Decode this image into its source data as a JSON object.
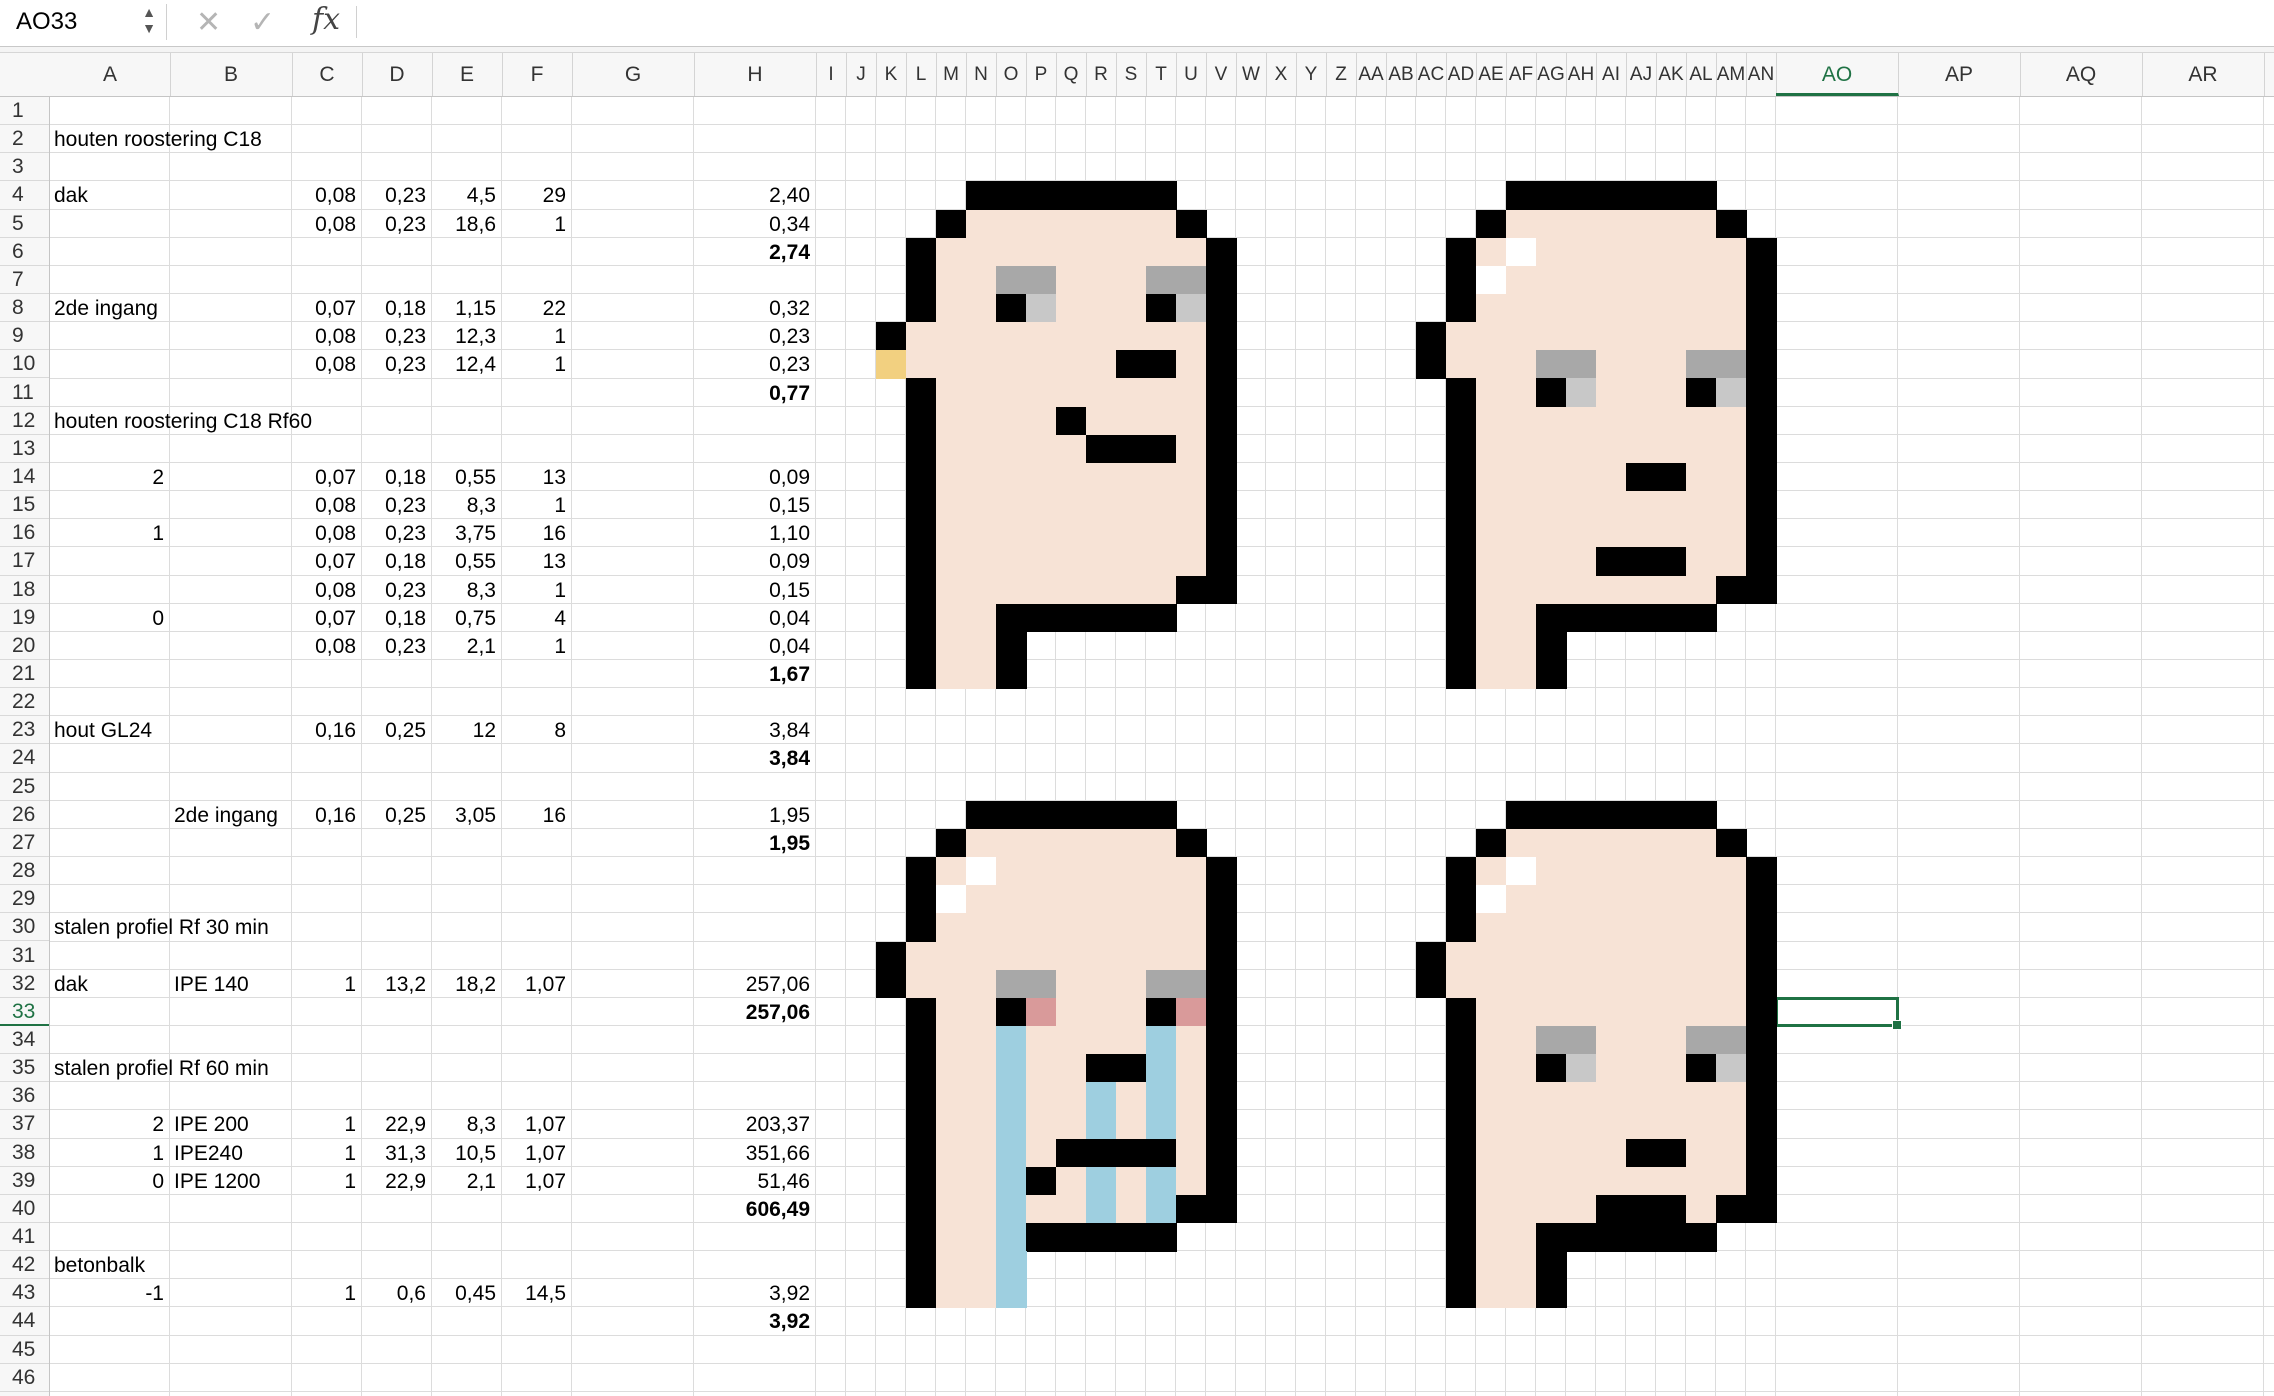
{
  "formula_bar": {
    "name_box": "AO33",
    "cancel_icon": "close-icon",
    "confirm_icon": "check-icon",
    "fx_label": "fx",
    "formula": ""
  },
  "colors": {
    "accent": "#1f7244",
    "skin": "#f7e3d6",
    "outline": "#000000",
    "eyebrow": "#a8a8a8",
    "eye_light": "#c8c8c8",
    "tear": "#9ecfe0",
    "eye_red": "#d99a9a",
    "earring": "#f2d080",
    "shine": "#ffffff"
  },
  "columns": [
    "A",
    "B",
    "C",
    "D",
    "E",
    "F",
    "G",
    "H",
    "I",
    "J",
    "K",
    "L",
    "M",
    "N",
    "O",
    "P",
    "Q",
    "R",
    "S",
    "T",
    "U",
    "V",
    "W",
    "X",
    "Y",
    "Z",
    "AA",
    "AB",
    "AC",
    "AD",
    "AE",
    "AF",
    "AG",
    "AH",
    "AI",
    "AJ",
    "AK",
    "AL",
    "AM",
    "AN",
    "AO",
    "AP",
    "AQ",
    "AR"
  ],
  "column_header_labels": [
    "A",
    "B",
    "C",
    "D",
    "E",
    "F",
    "G",
    "H",
    "I",
    "J",
    "K",
    "L",
    "M",
    "N",
    "O",
    "P",
    "Q",
    "R",
    "S",
    "T",
    "U",
    "V",
    "W",
    "X",
    "Y",
    "Z",
    "AA",
    "AB",
    "AC",
    "AD",
    "AE",
    "AF",
    "AG",
    "AH",
    "AI",
    "AJ",
    "AK",
    "AL",
    "AM",
    "AN",
    "AO",
    "AP",
    "AQ",
    "AR"
  ],
  "rows": [
    "1",
    "2",
    "3",
    "4",
    "5",
    "6",
    "7",
    "8",
    "9",
    "10",
    "11",
    "12",
    "13",
    "14",
    "15",
    "16",
    "17",
    "18",
    "19",
    "20",
    "21",
    "22",
    "23",
    "24",
    "25",
    "26",
    "27",
    "28",
    "29",
    "30",
    "31",
    "32",
    "33",
    "34",
    "35",
    "36",
    "37",
    "38",
    "39",
    "40",
    "41",
    "42",
    "43",
    "44",
    "45",
    "46"
  ],
  "active_cell": {
    "col": "AO",
    "row": "33"
  },
  "cells": [
    {
      "row": 2,
      "col": "A",
      "v": "houten roostering C18"
    },
    {
      "row": 4,
      "col": "A",
      "v": "dak"
    },
    {
      "row": 4,
      "col": "C",
      "v": "0,08",
      "r": 1
    },
    {
      "row": 4,
      "col": "D",
      "v": "0,23",
      "r": 1
    },
    {
      "row": 4,
      "col": "E",
      "v": "4,5",
      "r": 1
    },
    {
      "row": 4,
      "col": "F",
      "v": "29",
      "r": 1
    },
    {
      "row": 4,
      "col": "H",
      "v": "2,40",
      "r": 1
    },
    {
      "row": 5,
      "col": "C",
      "v": "0,08",
      "r": 1
    },
    {
      "row": 5,
      "col": "D",
      "v": "0,23",
      "r": 1
    },
    {
      "row": 5,
      "col": "E",
      "v": "18,6",
      "r": 1
    },
    {
      "row": 5,
      "col": "F",
      "v": "1",
      "r": 1
    },
    {
      "row": 5,
      "col": "H",
      "v": "0,34",
      "r": 1
    },
    {
      "row": 6,
      "col": "H",
      "v": "2,74",
      "r": 1,
      "b": 1
    },
    {
      "row": 8,
      "col": "A",
      "v": "2de ingang"
    },
    {
      "row": 8,
      "col": "C",
      "v": "0,07",
      "r": 1
    },
    {
      "row": 8,
      "col": "D",
      "v": "0,18",
      "r": 1
    },
    {
      "row": 8,
      "col": "E",
      "v": "1,15",
      "r": 1
    },
    {
      "row": 8,
      "col": "F",
      "v": "22",
      "r": 1
    },
    {
      "row": 8,
      "col": "H",
      "v": "0,32",
      "r": 1
    },
    {
      "row": 9,
      "col": "C",
      "v": "0,08",
      "r": 1
    },
    {
      "row": 9,
      "col": "D",
      "v": "0,23",
      "r": 1
    },
    {
      "row": 9,
      "col": "E",
      "v": "12,3",
      "r": 1
    },
    {
      "row": 9,
      "col": "F",
      "v": "1",
      "r": 1
    },
    {
      "row": 9,
      "col": "H",
      "v": "0,23",
      "r": 1
    },
    {
      "row": 10,
      "col": "C",
      "v": "0,08",
      "r": 1
    },
    {
      "row": 10,
      "col": "D",
      "v": "0,23",
      "r": 1
    },
    {
      "row": 10,
      "col": "E",
      "v": "12,4",
      "r": 1
    },
    {
      "row": 10,
      "col": "F",
      "v": "1",
      "r": 1
    },
    {
      "row": 10,
      "col": "H",
      "v": "0,23",
      "r": 1
    },
    {
      "row": 11,
      "col": "H",
      "v": "0,77",
      "r": 1,
      "b": 1
    },
    {
      "row": 12,
      "col": "A",
      "v": "houten roostering C18  Rf60"
    },
    {
      "row": 14,
      "col": "A",
      "v": "2",
      "r": 1
    },
    {
      "row": 14,
      "col": "C",
      "v": "0,07",
      "r": 1
    },
    {
      "row": 14,
      "col": "D",
      "v": "0,18",
      "r": 1
    },
    {
      "row": 14,
      "col": "E",
      "v": "0,55",
      "r": 1
    },
    {
      "row": 14,
      "col": "F",
      "v": "13",
      "r": 1
    },
    {
      "row": 14,
      "col": "H",
      "v": "0,09",
      "r": 1
    },
    {
      "row": 15,
      "col": "C",
      "v": "0,08",
      "r": 1
    },
    {
      "row": 15,
      "col": "D",
      "v": "0,23",
      "r": 1
    },
    {
      "row": 15,
      "col": "E",
      "v": "8,3",
      "r": 1
    },
    {
      "row": 15,
      "col": "F",
      "v": "1",
      "r": 1
    },
    {
      "row": 15,
      "col": "H",
      "v": "0,15",
      "r": 1
    },
    {
      "row": 16,
      "col": "A",
      "v": "1",
      "r": 1
    },
    {
      "row": 16,
      "col": "C",
      "v": "0,08",
      "r": 1
    },
    {
      "row": 16,
      "col": "D",
      "v": "0,23",
      "r": 1
    },
    {
      "row": 16,
      "col": "E",
      "v": "3,75",
      "r": 1
    },
    {
      "row": 16,
      "col": "F",
      "v": "16",
      "r": 1
    },
    {
      "row": 16,
      "col": "H",
      "v": "1,10",
      "r": 1
    },
    {
      "row": 17,
      "col": "C",
      "v": "0,07",
      "r": 1
    },
    {
      "row": 17,
      "col": "D",
      "v": "0,18",
      "r": 1
    },
    {
      "row": 17,
      "col": "E",
      "v": "0,55",
      "r": 1
    },
    {
      "row": 17,
      "col": "F",
      "v": "13",
      "r": 1
    },
    {
      "row": 17,
      "col": "H",
      "v": "0,09",
      "r": 1
    },
    {
      "row": 18,
      "col": "C",
      "v": "0,08",
      "r": 1
    },
    {
      "row": 18,
      "col": "D",
      "v": "0,23",
      "r": 1
    },
    {
      "row": 18,
      "col": "E",
      "v": "8,3",
      "r": 1
    },
    {
      "row": 18,
      "col": "F",
      "v": "1",
      "r": 1
    },
    {
      "row": 18,
      "col": "H",
      "v": "0,15",
      "r": 1
    },
    {
      "row": 19,
      "col": "A",
      "v": "0",
      "r": 1
    },
    {
      "row": 19,
      "col": "C",
      "v": "0,07",
      "r": 1
    },
    {
      "row": 19,
      "col": "D",
      "v": "0,18",
      "r": 1
    },
    {
      "row": 19,
      "col": "E",
      "v": "0,75",
      "r": 1
    },
    {
      "row": 19,
      "col": "F",
      "v": "4",
      "r": 1
    },
    {
      "row": 19,
      "col": "H",
      "v": "0,04",
      "r": 1
    },
    {
      "row": 20,
      "col": "C",
      "v": "0,08",
      "r": 1
    },
    {
      "row": 20,
      "col": "D",
      "v": "0,23",
      "r": 1
    },
    {
      "row": 20,
      "col": "E",
      "v": "2,1",
      "r": 1
    },
    {
      "row": 20,
      "col": "F",
      "v": "1",
      "r": 1
    },
    {
      "row": 20,
      "col": "H",
      "v": "0,04",
      "r": 1
    },
    {
      "row": 21,
      "col": "H",
      "v": "1,67",
      "r": 1,
      "b": 1
    },
    {
      "row": 23,
      "col": "A",
      "v": "hout GL24"
    },
    {
      "row": 23,
      "col": "C",
      "v": "0,16",
      "r": 1
    },
    {
      "row": 23,
      "col": "D",
      "v": "0,25",
      "r": 1
    },
    {
      "row": 23,
      "col": "E",
      "v": "12",
      "r": 1
    },
    {
      "row": 23,
      "col": "F",
      "v": "8",
      "r": 1
    },
    {
      "row": 23,
      "col": "H",
      "v": "3,84",
      "r": 1
    },
    {
      "row": 24,
      "col": "H",
      "v": "3,84",
      "r": 1,
      "b": 1
    },
    {
      "row": 26,
      "col": "B",
      "v": "2de ingang"
    },
    {
      "row": 26,
      "col": "C",
      "v": "0,16",
      "r": 1
    },
    {
      "row": 26,
      "col": "D",
      "v": "0,25",
      "r": 1
    },
    {
      "row": 26,
      "col": "E",
      "v": "3,05",
      "r": 1
    },
    {
      "row": 26,
      "col": "F",
      "v": "16",
      "r": 1
    },
    {
      "row": 26,
      "col": "H",
      "v": "1,95",
      "r": 1
    },
    {
      "row": 27,
      "col": "H",
      "v": "1,95",
      "r": 1,
      "b": 1
    },
    {
      "row": 30,
      "col": "A",
      "v": "stalen profiel Rf 30 min"
    },
    {
      "row": 32,
      "col": "A",
      "v": "dak"
    },
    {
      "row": 32,
      "col": "B",
      "v": "IPE 140"
    },
    {
      "row": 32,
      "col": "C",
      "v": "1",
      "r": 1
    },
    {
      "row": 32,
      "col": "D",
      "v": "13,2",
      "r": 1
    },
    {
      "row": 32,
      "col": "E",
      "v": "18,2",
      "r": 1
    },
    {
      "row": 32,
      "col": "F",
      "v": "1,07",
      "r": 1
    },
    {
      "row": 32,
      "col": "H",
      "v": "257,06",
      "r": 1
    },
    {
      "row": 33,
      "col": "H",
      "v": "257,06",
      "r": 1,
      "b": 1
    },
    {
      "row": 35,
      "col": "A",
      "v": "stalen profiel Rf 60 min"
    },
    {
      "row": 37,
      "col": "A",
      "v": "2",
      "r": 1
    },
    {
      "row": 37,
      "col": "B",
      "v": "IPE 200"
    },
    {
      "row": 37,
      "col": "C",
      "v": "1",
      "r": 1
    },
    {
      "row": 37,
      "col": "D",
      "v": "22,9",
      "r": 1
    },
    {
      "row": 37,
      "col": "E",
      "v": "8,3",
      "r": 1
    },
    {
      "row": 37,
      "col": "F",
      "v": "1,07",
      "r": 1
    },
    {
      "row": 37,
      "col": "H",
      "v": "203,37",
      "r": 1
    },
    {
      "row": 38,
      "col": "A",
      "v": "1",
      "r": 1
    },
    {
      "row": 38,
      "col": "B",
      "v": "IPE240"
    },
    {
      "row": 38,
      "col": "C",
      "v": "1",
      "r": 1
    },
    {
      "row": 38,
      "col": "D",
      "v": "31,3",
      "r": 1
    },
    {
      "row": 38,
      "col": "E",
      "v": "10,5",
      "r": 1
    },
    {
      "row": 38,
      "col": "F",
      "v": "1,07",
      "r": 1
    },
    {
      "row": 38,
      "col": "H",
      "v": "351,66",
      "r": 1
    },
    {
      "row": 39,
      "col": "A",
      "v": "0",
      "r": 1
    },
    {
      "row": 39,
      "col": "B",
      "v": "IPE 1200"
    },
    {
      "row": 39,
      "col": "C",
      "v": "1",
      "r": 1
    },
    {
      "row": 39,
      "col": "D",
      "v": "22,9",
      "r": 1
    },
    {
      "row": 39,
      "col": "E",
      "v": "2,1",
      "r": 1
    },
    {
      "row": 39,
      "col": "F",
      "v": "1,07",
      "r": 1
    },
    {
      "row": 39,
      "col": "H",
      "v": "51,46",
      "r": 1
    },
    {
      "row": 40,
      "col": "H",
      "v": "606,49",
      "r": 1,
      "b": 1
    },
    {
      "row": 42,
      "col": "A",
      "v": "betonbalk"
    },
    {
      "row": 43,
      "col": "A",
      "v": "-1",
      "r": 1
    },
    {
      "row": 43,
      "col": "C",
      "v": "1",
      "r": 1
    },
    {
      "row": 43,
      "col": "D",
      "v": "0,6",
      "r": 1
    },
    {
      "row": 43,
      "col": "E",
      "v": "0,45",
      "r": 1
    },
    {
      "row": 43,
      "col": "F",
      "v": "14,5",
      "r": 1
    },
    {
      "row": 43,
      "col": "H",
      "v": "3,92",
      "r": 1
    },
    {
      "row": 44,
      "col": "H",
      "v": "3,92",
      "r": 1,
      "b": 1
    }
  ],
  "pixel_faces": [
    {
      "name": "pixel-face-smirk",
      "variant": "smirk"
    },
    {
      "name": "pixel-face-neutral-top",
      "variant": "neutral"
    },
    {
      "name": "pixel-face-crying",
      "variant": "crying"
    },
    {
      "name": "pixel-face-neutral-bottom",
      "variant": "neutral2"
    }
  ]
}
